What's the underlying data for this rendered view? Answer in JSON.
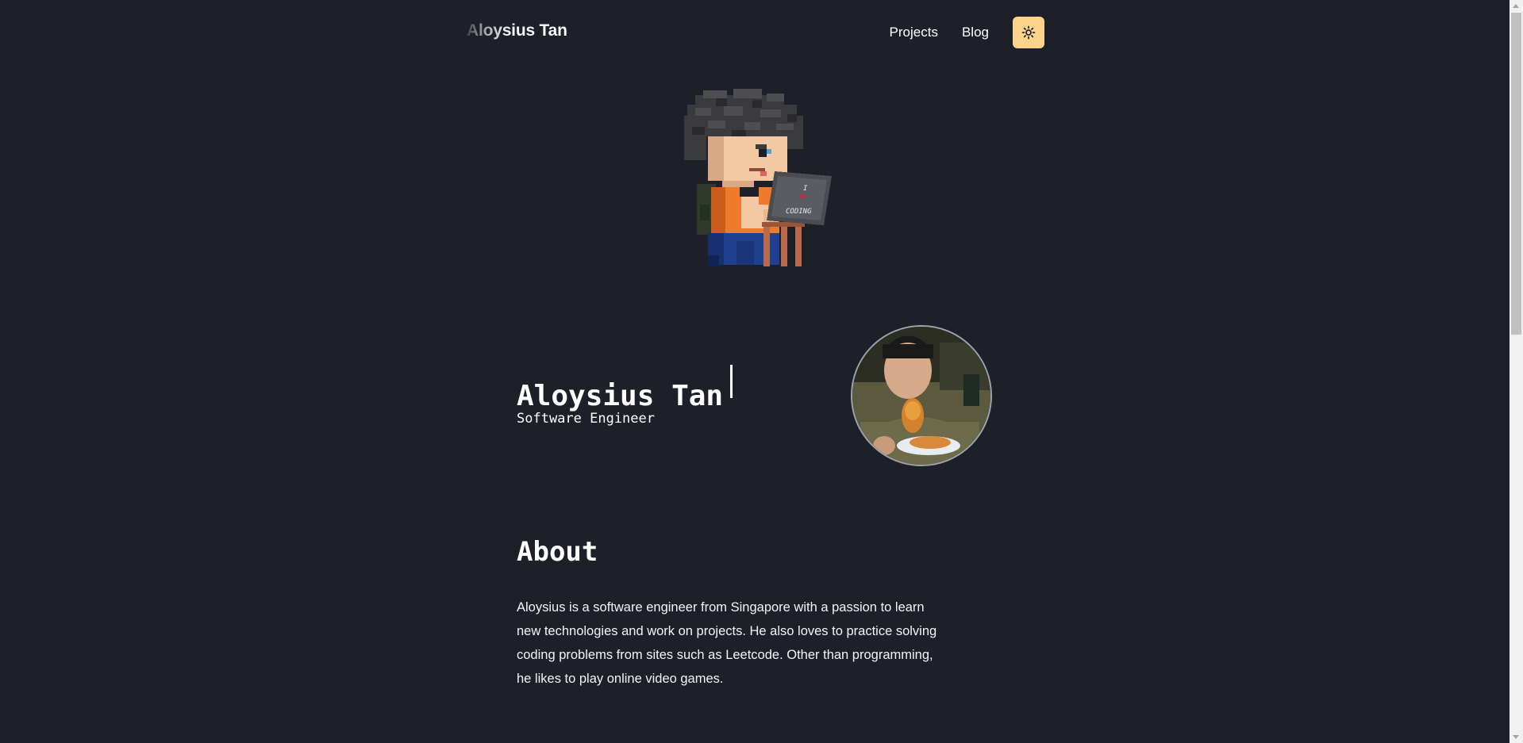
{
  "header": {
    "brand": "Aloysius Tan",
    "nav": [
      {
        "label": "Projects"
      },
      {
        "label": "Blog"
      }
    ],
    "theme_toggle_icon": "sun-icon"
  },
  "pixel_avatar": {
    "laptop_sticker": [
      "I",
      "CODING"
    ],
    "heart_icon": "heart-icon"
  },
  "hero": {
    "name": "Aloysius Tan",
    "role": "Software Engineer"
  },
  "about": {
    "heading": "About",
    "body": "Aloysius is a software engineer from Singapore with a passion to learn new technologies and work on projects. He also loves to practice solving coding problems from sites such as Leetcode. Other than programming, he likes to play online video games."
  },
  "colors": {
    "background": "#1e2029",
    "accent": "#fcd38b",
    "text": "#ffffff"
  }
}
